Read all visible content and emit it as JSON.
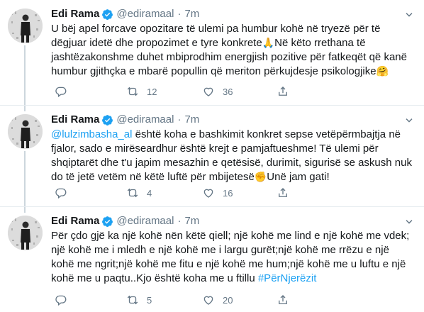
{
  "author": {
    "name": "Edi Rama",
    "handle": "@ediramaal",
    "separator": "·",
    "time": "7m"
  },
  "colors": {
    "link": "#1da1f2",
    "muted": "#657786",
    "verified": "#1da1f2",
    "like": "#657786"
  },
  "icons": {
    "reply": "reply-icon",
    "retweet": "retweet-icon",
    "like": "heart-icon",
    "share": "share-icon",
    "verified": "verified-badge-icon",
    "caret": "chevron-down-icon"
  },
  "tweets": [
    {
      "lines": [
        "U bëj apel forcave opozitare të ulemi pa humbur kohë në tryezë për të",
        "dëgjuar idetë dhe propozimet e tyre konkrete",
        "Në këto rrethana të",
        "jashtëzakonshme duhet mbiprodhim energjish pozitive për fatkeqët që kanë",
        "humbur gjithçka e mbarë popullin që meriton përkujdesje psikologjike"
      ],
      "emoji_pray": "🙏",
      "emoji_hug": "🤗",
      "reply_count": "",
      "retweet_count": "12",
      "like_count": "36"
    },
    {
      "mention": "@lulzimbasha_al",
      "lines": [
        " është koha e bashkimit konkret sepse vetëpërmbajtja në",
        "fjalor, sado e mirëseardhur është krejt e pamjaftueshme! Të ulemi për",
        "shqiptarët dhe t'u japim mesazhin e qetësisë, durimit, sigurisë se askush nuk",
        "do të jetë vetëm në këtë luftë për mbijetesë",
        "Unë jam gati!"
      ],
      "emoji_fist": "✊",
      "reply_count": "",
      "retweet_count": "4",
      "like_count": "16"
    },
    {
      "lines": [
        "Për çdo gjë ka një kohë nën këtë qiell; një kohë me lind e një kohë me vdek;",
        "një kohë me i mledh e një kohë me i largu gurët;një kohë me rrëzu e një",
        "kohë me ngrit;një kohë me fitu e një kohë me hum;një kohë me u luftu e një",
        "kohë me u paqtu..Kjo është koha me u ftillu "
      ],
      "hashtag": "#PërNjerëzit",
      "reply_count": "",
      "retweet_count": "5",
      "like_count": "20"
    }
  ]
}
